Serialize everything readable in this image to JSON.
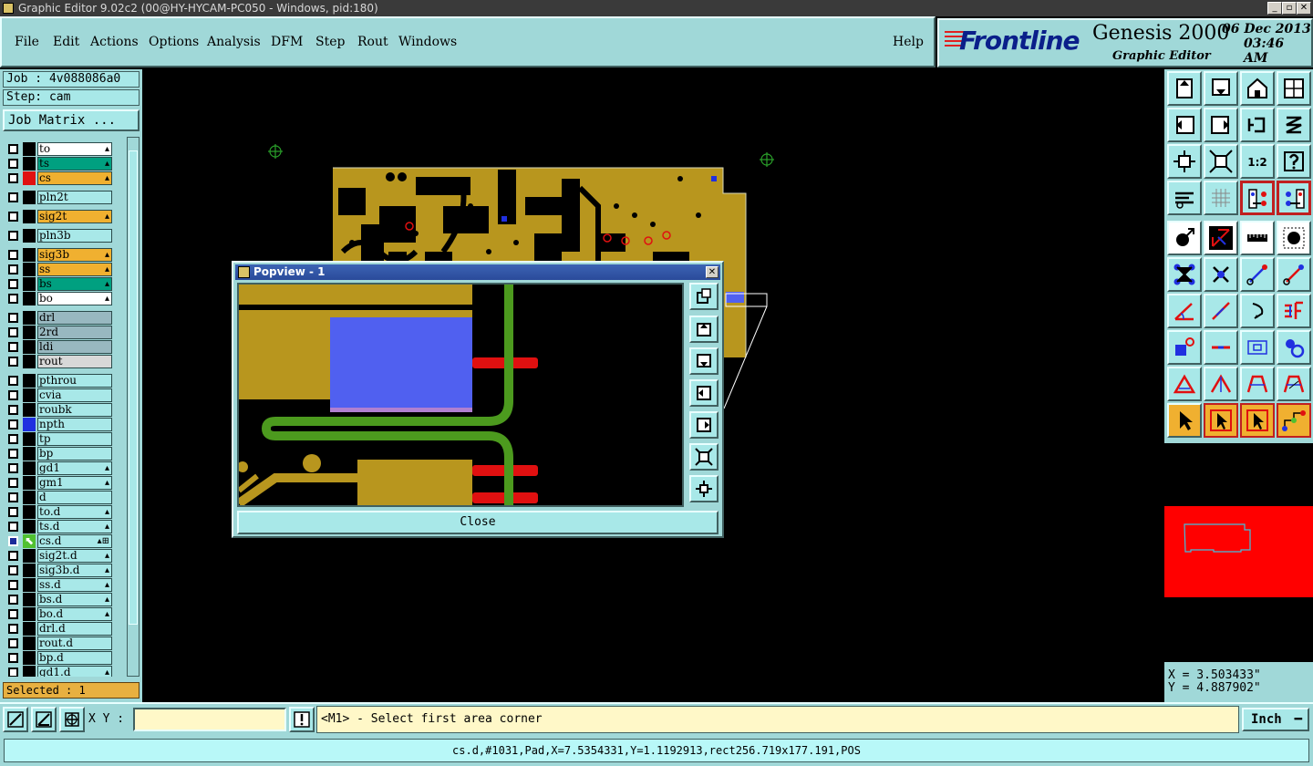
{
  "window": {
    "title": "Graphic Editor 9.02c2 (00@HY-HYCAM-PC050 - Windows, pid:180)",
    "min": "_",
    "max": "▫",
    "close": "✕"
  },
  "menu": {
    "file": "File",
    "edit": "Edit",
    "actions": "Actions",
    "options": "Options",
    "analysis": "Analysis",
    "dfm": "DFM",
    "step": "Step",
    "rout": "Rout",
    "windows": "Windows",
    "help": "Help"
  },
  "brand": {
    "name": "Frontline",
    "product": "Genesis 2000",
    "subtitle": "Graphic Editor",
    "date": "06 Dec 2013",
    "time": "03:46 AM"
  },
  "job": {
    "job_label": "Job : 4v088086a0",
    "step_label": "Step: cam",
    "matrix_button": "Job Matrix ..."
  },
  "layers": [
    {
      "name": "to",
      "bg": "#ffffff",
      "swatch": "#000000",
      "flag": "▴",
      "gap": 0
    },
    {
      "name": "ts",
      "bg": "#00a080",
      "swatch": "#000000",
      "flag": "▴",
      "gap": 0
    },
    {
      "name": "cs",
      "bg": "#f0b030",
      "swatch": "#e01010",
      "flag": "▴",
      "gap": 0
    },
    {
      "name": "pln2t",
      "bg": "#a8e8e8",
      "swatch": "#000000",
      "flag": "",
      "gap": 1
    },
    {
      "name": "sig2t",
      "bg": "#f0b030",
      "swatch": "#000000",
      "flag": "▴",
      "gap": 1
    },
    {
      "name": "pln3b",
      "bg": "#a8e8e8",
      "swatch": "#000000",
      "flag": "",
      "gap": 1
    },
    {
      "name": "sig3b",
      "bg": "#f0b030",
      "swatch": "#000000",
      "flag": "▴",
      "gap": 1
    },
    {
      "name": "ss",
      "bg": "#f0b030",
      "swatch": "#000000",
      "flag": "▴",
      "gap": 0
    },
    {
      "name": "bs",
      "bg": "#00a080",
      "swatch": "#000000",
      "flag": "▴",
      "gap": 0
    },
    {
      "name": "bo",
      "bg": "#ffffff",
      "swatch": "#000000",
      "flag": "▴",
      "gap": 0
    },
    {
      "name": "drl",
      "bg": "#98b8c0",
      "swatch": "#000000",
      "flag": "",
      "gap": 1
    },
    {
      "name": "2rd",
      "bg": "#98b8c0",
      "swatch": "#000000",
      "flag": "",
      "gap": 0
    },
    {
      "name": "ldi",
      "bg": "#98b8c0",
      "swatch": "#000000",
      "flag": "",
      "gap": 0
    },
    {
      "name": "rout",
      "bg": "#d8d8d8",
      "swatch": "#000000",
      "flag": "",
      "gap": 0
    },
    {
      "name": "pthrou",
      "bg": "#a8e8e8",
      "swatch": "#000000",
      "flag": "",
      "gap": 1
    },
    {
      "name": "cvia",
      "bg": "#a8e8e8",
      "swatch": "#000000",
      "flag": "",
      "gap": 0
    },
    {
      "name": "roubk",
      "bg": "#a8e8e8",
      "swatch": "#000000",
      "flag": "",
      "gap": 0
    },
    {
      "name": "npth",
      "bg": "#a8e8e8",
      "swatch": "#2030e0",
      "flag": "",
      "gap": 0
    },
    {
      "name": "tp",
      "bg": "#a8e8e8",
      "swatch": "#000000",
      "flag": "",
      "gap": 0
    },
    {
      "name": "bp",
      "bg": "#a8e8e8",
      "swatch": "#000000",
      "flag": "",
      "gap": 0
    },
    {
      "name": "gd1",
      "bg": "#a8e8e8",
      "swatch": "#000000",
      "flag": "▴",
      "gap": 0
    },
    {
      "name": "gm1",
      "bg": "#a8e8e8",
      "swatch": "#000000",
      "flag": "▴",
      "gap": 0
    },
    {
      "name": "d",
      "bg": "#a8e8e8",
      "swatch": "#000000",
      "flag": "",
      "gap": 0
    },
    {
      "name": "to.d",
      "bg": "#a8e8e8",
      "swatch": "#000000",
      "flag": "▴",
      "gap": 0
    },
    {
      "name": "ts.d",
      "bg": "#a8e8e8",
      "swatch": "#000000",
      "flag": "▴",
      "gap": 0
    },
    {
      "name": "cs.d",
      "bg": "#a8e8e8",
      "swatch": "#50c030",
      "flag": "▴⊞",
      "gap": 0,
      "active": true
    },
    {
      "name": "sig2t.d",
      "bg": "#a8e8e8",
      "swatch": "#000000",
      "flag": "▴",
      "gap": 0
    },
    {
      "name": "sig3b.d",
      "bg": "#a8e8e8",
      "swatch": "#000000",
      "flag": "▴",
      "gap": 0
    },
    {
      "name": "ss.d",
      "bg": "#a8e8e8",
      "swatch": "#000000",
      "flag": "▴",
      "gap": 0
    },
    {
      "name": "bs.d",
      "bg": "#a8e8e8",
      "swatch": "#000000",
      "flag": "▴",
      "gap": 0
    },
    {
      "name": "bo.d",
      "bg": "#a8e8e8",
      "swatch": "#000000",
      "flag": "▴",
      "gap": 0
    },
    {
      "name": "drl.d",
      "bg": "#a8e8e8",
      "swatch": "#000000",
      "flag": "",
      "gap": 0
    },
    {
      "name": "rout.d",
      "bg": "#a8e8e8",
      "swatch": "#000000",
      "flag": "",
      "gap": 0
    },
    {
      "name": "bp.d",
      "bg": "#a8e8e8",
      "swatch": "#000000",
      "flag": "",
      "gap": 0
    },
    {
      "name": "gd1.d",
      "bg": "#a8e8e8",
      "swatch": "#000000",
      "flag": "▴",
      "gap": 0
    }
  ],
  "selected": "Selected : 1",
  "popview": {
    "title": "Popview - 1",
    "close_label": "Close"
  },
  "toolbox_buttons": [
    "zoom-home",
    "zoom-down",
    "home",
    "pan-window",
    "zoom-left",
    "zoom-right",
    "flip",
    "snap",
    "fit-vertical",
    "fit-all",
    "ratio-1-2",
    "query",
    "measure-tools",
    "grid",
    "layer-red-1",
    "layer-red-2",
    "feature-select",
    "net-highlight",
    "ruler",
    "pad",
    "connect",
    "cross",
    "line-add",
    "line-edit",
    "angle",
    "slash",
    "arc",
    "tf",
    "pad-add",
    "line-mid",
    "box",
    "circles",
    "tri-1",
    "tri-2",
    "tri-3",
    "tri-4",
    "pointer",
    "pointer-box",
    "pointer-highlight",
    "route"
  ],
  "ratio_text": "1:2",
  "coords": {
    "x": "X = 3.503433\"",
    "y": "Y = 4.887902\""
  },
  "bottom": {
    "xy_label": "X Y :",
    "xy_value": "",
    "prompt": "<M1> - Select first area corner",
    "units": "Inch",
    "status": "cs.d,#1031,Pad,X=7.5354331,Y=1.1192913,rect256.719x177.191,POS"
  },
  "colors": {
    "copper": "#b8961e",
    "trace": "#4c9a1e",
    "pad_red": "#e01010",
    "selection": "#5060f0",
    "panel": "#a0d8d8"
  }
}
